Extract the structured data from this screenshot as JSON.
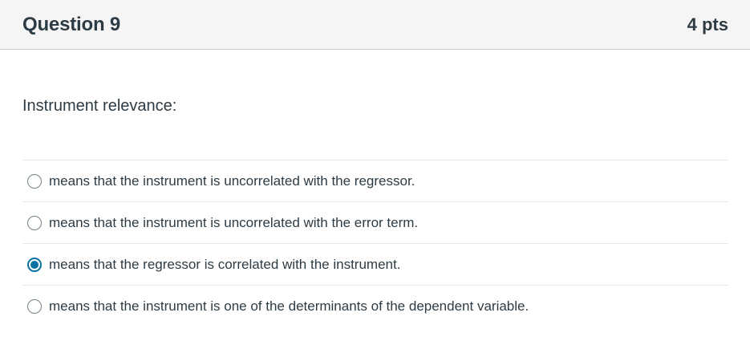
{
  "question": {
    "title": "Question 9",
    "points": "4 pts",
    "prompt": "Instrument relevance:",
    "selected_index": 2,
    "accent_color": "#0770a3",
    "answers": [
      {
        "label": "means that the instrument is uncorrelated with the regressor.",
        "selected": false
      },
      {
        "label": "means that the instrument is uncorrelated with the error term.",
        "selected": false
      },
      {
        "label": "means that the regressor is correlated with the instrument.",
        "selected": true
      },
      {
        "label": "means that the instrument is one of the determinants of the dependent variable.",
        "selected": false
      }
    ]
  }
}
